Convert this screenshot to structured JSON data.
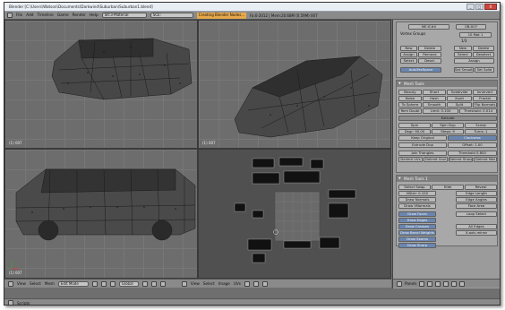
{
  "window": {
    "title": "Blender [C:\\Users\\Watson\\Documents\\Darkwind\\Suburban\\Suburban1.blend]",
    "min_label": "_",
    "max_label": "□",
    "close_label": "X"
  },
  "topbar": {
    "menus": [
      "File",
      "Add",
      "Timeline",
      "Game",
      "Render",
      "Help"
    ],
    "screen_field": "SR:3-Material",
    "scene_field": "SCE:",
    "status_orange": "Creating Blender Nodes...",
    "stats": "Fa:0-2012 | Mem:20.68M (0.59M) 007"
  },
  "viewports": {
    "top_left_label": "(1) 007",
    "top_right_label": "(1) 007",
    "bottom_left_label": "(1) 007"
  },
  "viewport_header": {
    "items": [
      "View",
      "Select",
      "Mesh"
    ],
    "mode": "Edit Mode",
    "pivot": "Global"
  },
  "uv_header": {
    "items": [
      "View",
      "Select",
      "Image",
      "UVs"
    ]
  },
  "panel_header": {
    "label": "Panels"
  },
  "bottom_status": {
    "scripts_label": "Scripts"
  },
  "right_panel": {
    "name_field": "ME:IC#0",
    "ob_field": "OB:007",
    "vertex_groups": "Vertex Groups",
    "mat_field": "10 Mat 1",
    "index_field": "1/3",
    "mat_buttons": [
      "New",
      "Delete",
      "New",
      "Delete",
      "Assign",
      "Remove",
      "Select",
      "Deselect",
      "Select",
      "Desel.",
      "Assign"
    ],
    "autotex": "AutoTexSpace",
    "set_smooth": "Set Smooth",
    "set_solid": "Set Solid",
    "mesh_tools_title": "Mesh Tools",
    "mesh_tools": [
      [
        "Beauty",
        "Short",
        "Subdivide",
        "Innervert"
      ],
      [
        "Noise",
        "Hash",
        "Xsort",
        "Fractal"
      ],
      [
        "To Sphere",
        "Smooth",
        "Split",
        "Flip Normals"
      ],
      [
        "Rem Doubl",
        "Limit: 0.100",
        "Threshold: 0.014"
      ]
    ],
    "extrude": "Extrude",
    "spin": "Spin",
    "spin_dup": "Spin Dup",
    "screw": "Screw",
    "degr": "Degr: 90.00",
    "steps": "Steps: 9",
    "turns": "Turns: 1",
    "keep_original": "Keep Original",
    "clockwise": "Clockwise",
    "extrude_dup": "Extrude Dup",
    "offset": "Offset: 1.00",
    "join_triangles": "Join Triangles",
    "threshold": "Threshold 0.800",
    "delimit": [
      "Delimit UVs",
      "Delimit Vcol",
      "Delimit Sharp",
      "Delimit Mat"
    ],
    "mesh_tools1_title": "Mesh Tools 1",
    "mt1_select": "Select Swap",
    "mt1_hide": "Hide",
    "mt1_reveal": "Reveal",
    "nsize": "NSize: 0.100",
    "edge_length": "Edge Length",
    "draw_normals": "Draw Normals",
    "edge_angles": "Edge Angles",
    "draw_vnormals": "Draw VNormals",
    "face_area": "Face Area",
    "draw_faces": "Draw Faces",
    "loop_select": "Loop Select",
    "draw_edges": "Draw Edges",
    "draw_creases": "Draw Creases",
    "all_edges": "All Edges",
    "draw_bevel": "Draw Bevel Weights",
    "x_axis_mirror": "X-axis mirror",
    "draw_seams": "Draw Seams",
    "draw_sharp": "Draw Sharp"
  },
  "colors": {
    "accent_blue": "#6a86b0",
    "status_orange": "#e6a84a",
    "viewport_gray": "#6d6d6d"
  }
}
